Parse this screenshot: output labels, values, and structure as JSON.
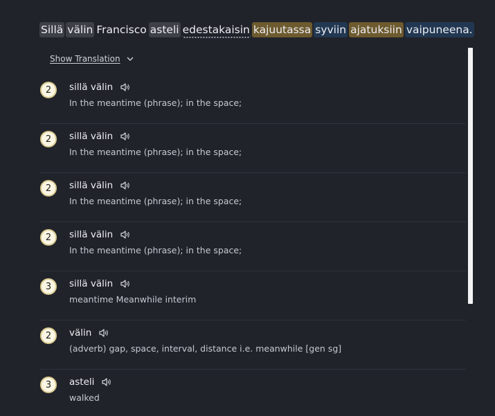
{
  "sentence": {
    "words": [
      {
        "text": "Sillä",
        "style": "grey"
      },
      {
        "text": "välin",
        "style": "grey"
      },
      {
        "text": "Francisco",
        "style": "none"
      },
      {
        "text": "asteli",
        "style": "grey"
      },
      {
        "text": "edestakaisin",
        "style": "dot"
      },
      {
        "text": "kajuutassa",
        "style": "gold"
      },
      {
        "text": "syviin",
        "style": "blue"
      },
      {
        "text": "ajatuksiin",
        "style": "gold"
      },
      {
        "text": "vaipuneena.",
        "style": "blue"
      }
    ]
  },
  "show_translation": {
    "label": "Show Translation"
  },
  "entries": [
    {
      "level": "2",
      "term": "sillä välin",
      "definition": "In the meantime (phrase); in the space;"
    },
    {
      "level": "2",
      "term": "sillä välin",
      "definition": "In the meantime (phrase); in the space;"
    },
    {
      "level": "2",
      "term": "sillä välin",
      "definition": "In the meantime (phrase); in the space;"
    },
    {
      "level": "2",
      "term": "sillä välin",
      "definition": "In the meantime (phrase); in the space;"
    },
    {
      "level": "3",
      "term": "sillä välin",
      "definition": "meantime Meanwhile interim"
    },
    {
      "level": "2",
      "term": "välin",
      "definition": "(adverb) gap, space, interval, distance i.e. meanwhile [gen sg]"
    },
    {
      "level": "3",
      "term": "asteli",
      "definition": "walked"
    }
  ],
  "icons": {
    "speaker": "speaker-icon",
    "chevron": "chevron-down-icon"
  },
  "colors": {
    "background": "#21232a",
    "word_grey": "#3e4048",
    "word_gold": "#6d5a2e",
    "word_blue": "#223852",
    "badge_fill": "#fbf6e4",
    "badge_border": "#d9c98e"
  }
}
